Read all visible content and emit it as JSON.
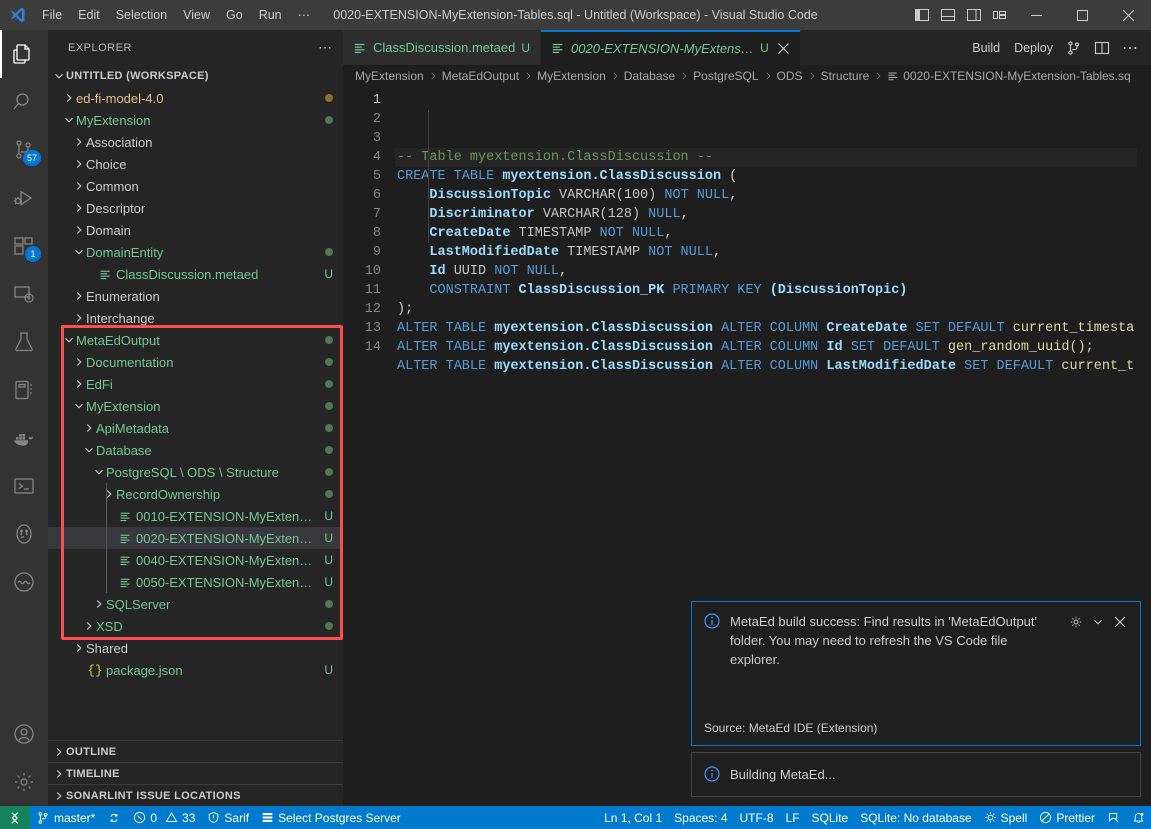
{
  "titlebar": {
    "logo_icon": "vscode-logo-icon",
    "menus": [
      "File",
      "Edit",
      "Selection",
      "View",
      "Go",
      "Run",
      "⋯"
    ],
    "window_title": "0020-EXTENSION-MyExtension-Tables.sql - Untitled (Workspace) - Visual Studio Code",
    "layout_icons": [
      "toggle-primary-sidebar-icon",
      "toggle-panel-icon",
      "toggle-secondary-sidebar-icon",
      "customize-layout-icon"
    ],
    "window_controls": [
      "minimize",
      "maximize",
      "close"
    ]
  },
  "activitybar": {
    "items": [
      {
        "name": "explorer",
        "icon": "files-icon",
        "active": true,
        "badge": null
      },
      {
        "name": "search",
        "icon": "search-icon",
        "active": false,
        "badge": null
      },
      {
        "name": "source-control",
        "icon": "source-control-icon",
        "active": false,
        "badge": "57"
      },
      {
        "name": "run-and-debug",
        "icon": "debug-icon",
        "active": false,
        "badge": null
      },
      {
        "name": "extensions",
        "icon": "extensions-icon",
        "active": false,
        "badge": "1"
      },
      {
        "name": "remote-explorer",
        "icon": "remote-explorer-icon",
        "active": false,
        "badge": null
      },
      {
        "name": "testing",
        "icon": "beaker-icon",
        "active": false,
        "badge": null
      },
      {
        "name": "notebook",
        "icon": "notebook-icon",
        "active": false,
        "badge": null
      },
      {
        "name": "docker",
        "icon": "docker-whale-icon",
        "active": false,
        "badge": null
      },
      {
        "name": "terminal-manager",
        "icon": "terminal-icon",
        "active": false,
        "badge": null
      },
      {
        "name": "postgresql",
        "icon": "postgres-elephant-icon",
        "active": false,
        "badge": null
      },
      {
        "name": "sonarlint",
        "icon": "sonar-icon",
        "active": false,
        "badge": null
      }
    ],
    "bottom": [
      {
        "name": "accounts",
        "icon": "account-icon"
      },
      {
        "name": "manage",
        "icon": "gear-icon"
      }
    ]
  },
  "sidebar": {
    "title": "EXPLORER",
    "more_actions_icon": "ellipsis-icon",
    "tree": [
      {
        "label": "UNTITLED (WORKSPACE)",
        "depth": 0,
        "type": "root",
        "state": "expanded",
        "color": "default",
        "badge": null,
        "dot": null
      },
      {
        "label": "ed-fi-model-4.0",
        "depth": 1,
        "type": "folder",
        "state": "collapsed",
        "color": "yellow",
        "badge": null,
        "dot": "yellow"
      },
      {
        "label": "MyExtension",
        "depth": 1,
        "type": "folder",
        "state": "expanded",
        "color": "green",
        "badge": null,
        "dot": "green"
      },
      {
        "label": "Association",
        "depth": 2,
        "type": "folder",
        "state": "collapsed",
        "color": "default",
        "badge": null,
        "dot": null
      },
      {
        "label": "Choice",
        "depth": 2,
        "type": "folder",
        "state": "collapsed",
        "color": "default",
        "badge": null,
        "dot": null
      },
      {
        "label": "Common",
        "depth": 2,
        "type": "folder",
        "state": "collapsed",
        "color": "default",
        "badge": null,
        "dot": null
      },
      {
        "label": "Descriptor",
        "depth": 2,
        "type": "folder",
        "state": "collapsed",
        "color": "default",
        "badge": null,
        "dot": null
      },
      {
        "label": "Domain",
        "depth": 2,
        "type": "folder",
        "state": "collapsed",
        "color": "default",
        "badge": null,
        "dot": null
      },
      {
        "label": "DomainEntity",
        "depth": 2,
        "type": "folder",
        "state": "expanded",
        "color": "green",
        "badge": null,
        "dot": "green"
      },
      {
        "label": "ClassDiscussion.metaed",
        "depth": 3,
        "type": "file",
        "state": "none",
        "color": "green",
        "badge": "U",
        "dot": null
      },
      {
        "label": "Enumeration",
        "depth": 2,
        "type": "folder",
        "state": "collapsed",
        "color": "default",
        "badge": null,
        "dot": null
      },
      {
        "label": "Interchange",
        "depth": 2,
        "type": "folder",
        "state": "collapsed",
        "color": "default",
        "badge": null,
        "dot": null
      },
      {
        "label": "MetaEdOutput",
        "depth": 1,
        "type": "folder",
        "state": "expanded",
        "color": "green",
        "badge": null,
        "dot": "green"
      },
      {
        "label": "Documentation",
        "depth": 2,
        "type": "folder",
        "state": "collapsed",
        "color": "green",
        "badge": null,
        "dot": "green"
      },
      {
        "label": "EdFi",
        "depth": 2,
        "type": "folder",
        "state": "collapsed",
        "color": "green",
        "badge": null,
        "dot": "green"
      },
      {
        "label": "MyExtension",
        "depth": 2,
        "type": "folder",
        "state": "expanded",
        "color": "green",
        "badge": null,
        "dot": "green"
      },
      {
        "label": "ApiMetadata",
        "depth": 3,
        "type": "folder",
        "state": "collapsed",
        "color": "green",
        "badge": null,
        "dot": "green"
      },
      {
        "label": "Database",
        "depth": 3,
        "type": "folder",
        "state": "expanded",
        "color": "green",
        "badge": null,
        "dot": "green"
      },
      {
        "label": "PostgreSQL \\ ODS \\ Structure",
        "depth": 4,
        "type": "folder",
        "state": "expanded",
        "color": "green",
        "badge": null,
        "dot": "green"
      },
      {
        "label": "RecordOwnership",
        "depth": 5,
        "type": "folder",
        "state": "collapsed",
        "color": "green",
        "badge": null,
        "dot": "green"
      },
      {
        "label": "0010-EXTENSION-MyExtensio…",
        "depth": 5,
        "type": "file",
        "state": "none",
        "color": "green",
        "badge": "U",
        "dot": null
      },
      {
        "label": "0020-EXTENSION-MyExtensio…",
        "depth": 5,
        "type": "file",
        "state": "none",
        "color": "green",
        "badge": "U",
        "dot": null,
        "selected": true
      },
      {
        "label": "0040-EXTENSION-MyExtensio…",
        "depth": 5,
        "type": "file",
        "state": "none",
        "color": "green",
        "badge": "U",
        "dot": null
      },
      {
        "label": "0050-EXTENSION-MyExtensio…",
        "depth": 5,
        "type": "file",
        "state": "none",
        "color": "green",
        "badge": "U",
        "dot": null
      },
      {
        "label": "SQLServer",
        "depth": 4,
        "type": "folder",
        "state": "collapsed",
        "color": "green",
        "badge": null,
        "dot": "green"
      },
      {
        "label": "XSD",
        "depth": 3,
        "type": "folder",
        "state": "collapsed",
        "color": "green",
        "badge": null,
        "dot": "green"
      },
      {
        "label": "Shared",
        "depth": 2,
        "type": "folder",
        "state": "collapsed",
        "color": "default",
        "badge": null,
        "dot": null
      },
      {
        "label": "package.json",
        "depth": 2,
        "type": "json",
        "state": "none",
        "color": "green",
        "badge": "U",
        "dot": null
      }
    ],
    "sections": [
      "OUTLINE",
      "TIMELINE",
      "SONARLINT ISSUE LOCATIONS"
    ],
    "highlight_color": "#ff4d4d"
  },
  "editor": {
    "tabs": [
      {
        "label": "ClassDiscussion.metaed",
        "badge": "U",
        "active": false,
        "icon": "sql-file-icon",
        "closable": false
      },
      {
        "label": "0020-EXTENSION-MyExtension-Tables.sql",
        "badge": "U",
        "active": true,
        "icon": "sql-file-icon",
        "closable": true
      }
    ],
    "tab_actions": {
      "build_label": "Build",
      "deploy_label": "Deploy",
      "icons": [
        "source-control-icon",
        "split-editor-icon",
        "more-actions-icon"
      ]
    },
    "breadcrumbs": [
      "MyExtension",
      "MetaEdOutput",
      "MyExtension",
      "Database",
      "PostgreSQL",
      "ODS",
      "Structure",
      "0020-EXTENSION-MyExtension-Tables.sq"
    ],
    "line_count": 14,
    "active_line": 1,
    "lines": [
      {
        "n": 1,
        "tokens": [
          {
            "t": "-- Table myextension.ClassDiscussion --",
            "c": "cmt"
          }
        ]
      },
      {
        "n": 2,
        "tokens": [
          {
            "t": "CREATE TABLE ",
            "c": "kw"
          },
          {
            "t": "myextension.ClassDiscussion",
            "c": "id"
          },
          {
            "t": " (",
            "c": "pn"
          }
        ]
      },
      {
        "n": 3,
        "tokens": [
          {
            "t": "    ",
            "c": "pn"
          },
          {
            "t": "DiscussionTopic",
            "c": "id"
          },
          {
            "t": " VARCHAR(100)",
            "c": "typ"
          },
          {
            "t": " NOT NULL",
            "c": "kw"
          },
          {
            "t": ",",
            "c": "pn"
          }
        ]
      },
      {
        "n": 4,
        "tokens": [
          {
            "t": "    ",
            "c": "pn"
          },
          {
            "t": "Discriminator",
            "c": "id"
          },
          {
            "t": " VARCHAR(128)",
            "c": "typ"
          },
          {
            "t": " NULL",
            "c": "kw"
          },
          {
            "t": ",",
            "c": "pn"
          }
        ]
      },
      {
        "n": 5,
        "tokens": [
          {
            "t": "    ",
            "c": "pn"
          },
          {
            "t": "CreateDate",
            "c": "id"
          },
          {
            "t": " TIMESTAMP",
            "c": "typ"
          },
          {
            "t": " NOT NULL",
            "c": "kw"
          },
          {
            "t": ",",
            "c": "pn"
          }
        ]
      },
      {
        "n": 6,
        "tokens": [
          {
            "t": "    ",
            "c": "pn"
          },
          {
            "t": "LastModifiedDate",
            "c": "id"
          },
          {
            "t": " TIMESTAMP",
            "c": "typ"
          },
          {
            "t": " NOT NULL",
            "c": "kw"
          },
          {
            "t": ",",
            "c": "pn"
          }
        ]
      },
      {
        "n": 7,
        "tokens": [
          {
            "t": "    ",
            "c": "pn"
          },
          {
            "t": "Id",
            "c": "id"
          },
          {
            "t": " UUID",
            "c": "typ"
          },
          {
            "t": " NOT NULL",
            "c": "kw"
          },
          {
            "t": ",",
            "c": "pn"
          }
        ]
      },
      {
        "n": 8,
        "tokens": [
          {
            "t": "    ",
            "c": "pn"
          },
          {
            "t": "CONSTRAINT ",
            "c": "kw"
          },
          {
            "t": "ClassDiscussion_PK",
            "c": "id"
          },
          {
            "t": " PRIMARY KEY ",
            "c": "kw"
          },
          {
            "t": "(DiscussionTopic)",
            "c": "id"
          }
        ]
      },
      {
        "n": 9,
        "tokens": [
          {
            "t": ");",
            "c": "pn"
          }
        ]
      },
      {
        "n": 10,
        "tokens": [
          {
            "t": "ALTER TABLE ",
            "c": "kw"
          },
          {
            "t": "myextension.ClassDiscussion",
            "c": "id"
          },
          {
            "t": " ALTER COLUMN ",
            "c": "kw"
          },
          {
            "t": "CreateDate",
            "c": "id"
          },
          {
            "t": " SET DEFAULT ",
            "c": "kw"
          },
          {
            "t": "current_timesta",
            "c": "fn"
          }
        ]
      },
      {
        "n": 11,
        "tokens": [
          {
            "t": "ALTER TABLE ",
            "c": "kw"
          },
          {
            "t": "myextension.ClassDiscussion",
            "c": "id"
          },
          {
            "t": " ALTER COLUMN ",
            "c": "kw"
          },
          {
            "t": "Id",
            "c": "id"
          },
          {
            "t": " SET DEFAULT ",
            "c": "kw"
          },
          {
            "t": "gen_random_uuid();",
            "c": "fn"
          }
        ]
      },
      {
        "n": 12,
        "tokens": [
          {
            "t": "ALTER TABLE ",
            "c": "kw"
          },
          {
            "t": "myextension.ClassDiscussion",
            "c": "id"
          },
          {
            "t": " ALTER COLUMN ",
            "c": "kw"
          },
          {
            "t": "LastModifiedDate",
            "c": "id"
          },
          {
            "t": " SET DEFAULT ",
            "c": "kw"
          },
          {
            "t": "current_t",
            "c": "fn"
          }
        ]
      },
      {
        "n": 13,
        "tokens": []
      },
      {
        "n": 14,
        "tokens": []
      }
    ]
  },
  "notifications": [
    {
      "icon": "info-icon",
      "message": "MetaEd build success: Find results in 'MetaEdOutput' folder. You may need to refresh the VS Code file explorer.",
      "source": "Source: MetaEd IDE (Extension)",
      "actions": [
        "gear-icon",
        "chevron-down-icon",
        "close-icon"
      ],
      "primary": true
    },
    {
      "icon": "info-icon",
      "message": "Building MetaEd...",
      "source": null,
      "actions": [],
      "primary": false
    }
  ],
  "statusbar": {
    "remote_icon": "remote-indicator-icon",
    "left": [
      {
        "icon": "git-branch-icon",
        "label": "master*"
      },
      {
        "icon": "sync-icon",
        "label": ""
      },
      {
        "icon": "error-warning-icon",
        "label": "0  33"
      },
      {
        "icon": "shield-icon",
        "label": "Sarif"
      },
      {
        "icon": "database-icon",
        "label": "Select Postgres Server"
      }
    ],
    "errors": "0",
    "warnings": "33",
    "right": [
      {
        "icon": null,
        "label": "Ln 1, Col 1"
      },
      {
        "icon": null,
        "label": "Spaces: 4"
      },
      {
        "icon": null,
        "label": "UTF-8"
      },
      {
        "icon": null,
        "label": "LF"
      },
      {
        "icon": null,
        "label": "SQLite"
      },
      {
        "icon": null,
        "label": "SQLite: No database"
      },
      {
        "icon": "spell-icon",
        "label": "Spell"
      },
      {
        "icon": "prettier-icon",
        "label": "Prettier"
      },
      {
        "icon": "feedback-icon",
        "label": ""
      },
      {
        "icon": "bell-dot-icon",
        "label": ""
      }
    ]
  }
}
